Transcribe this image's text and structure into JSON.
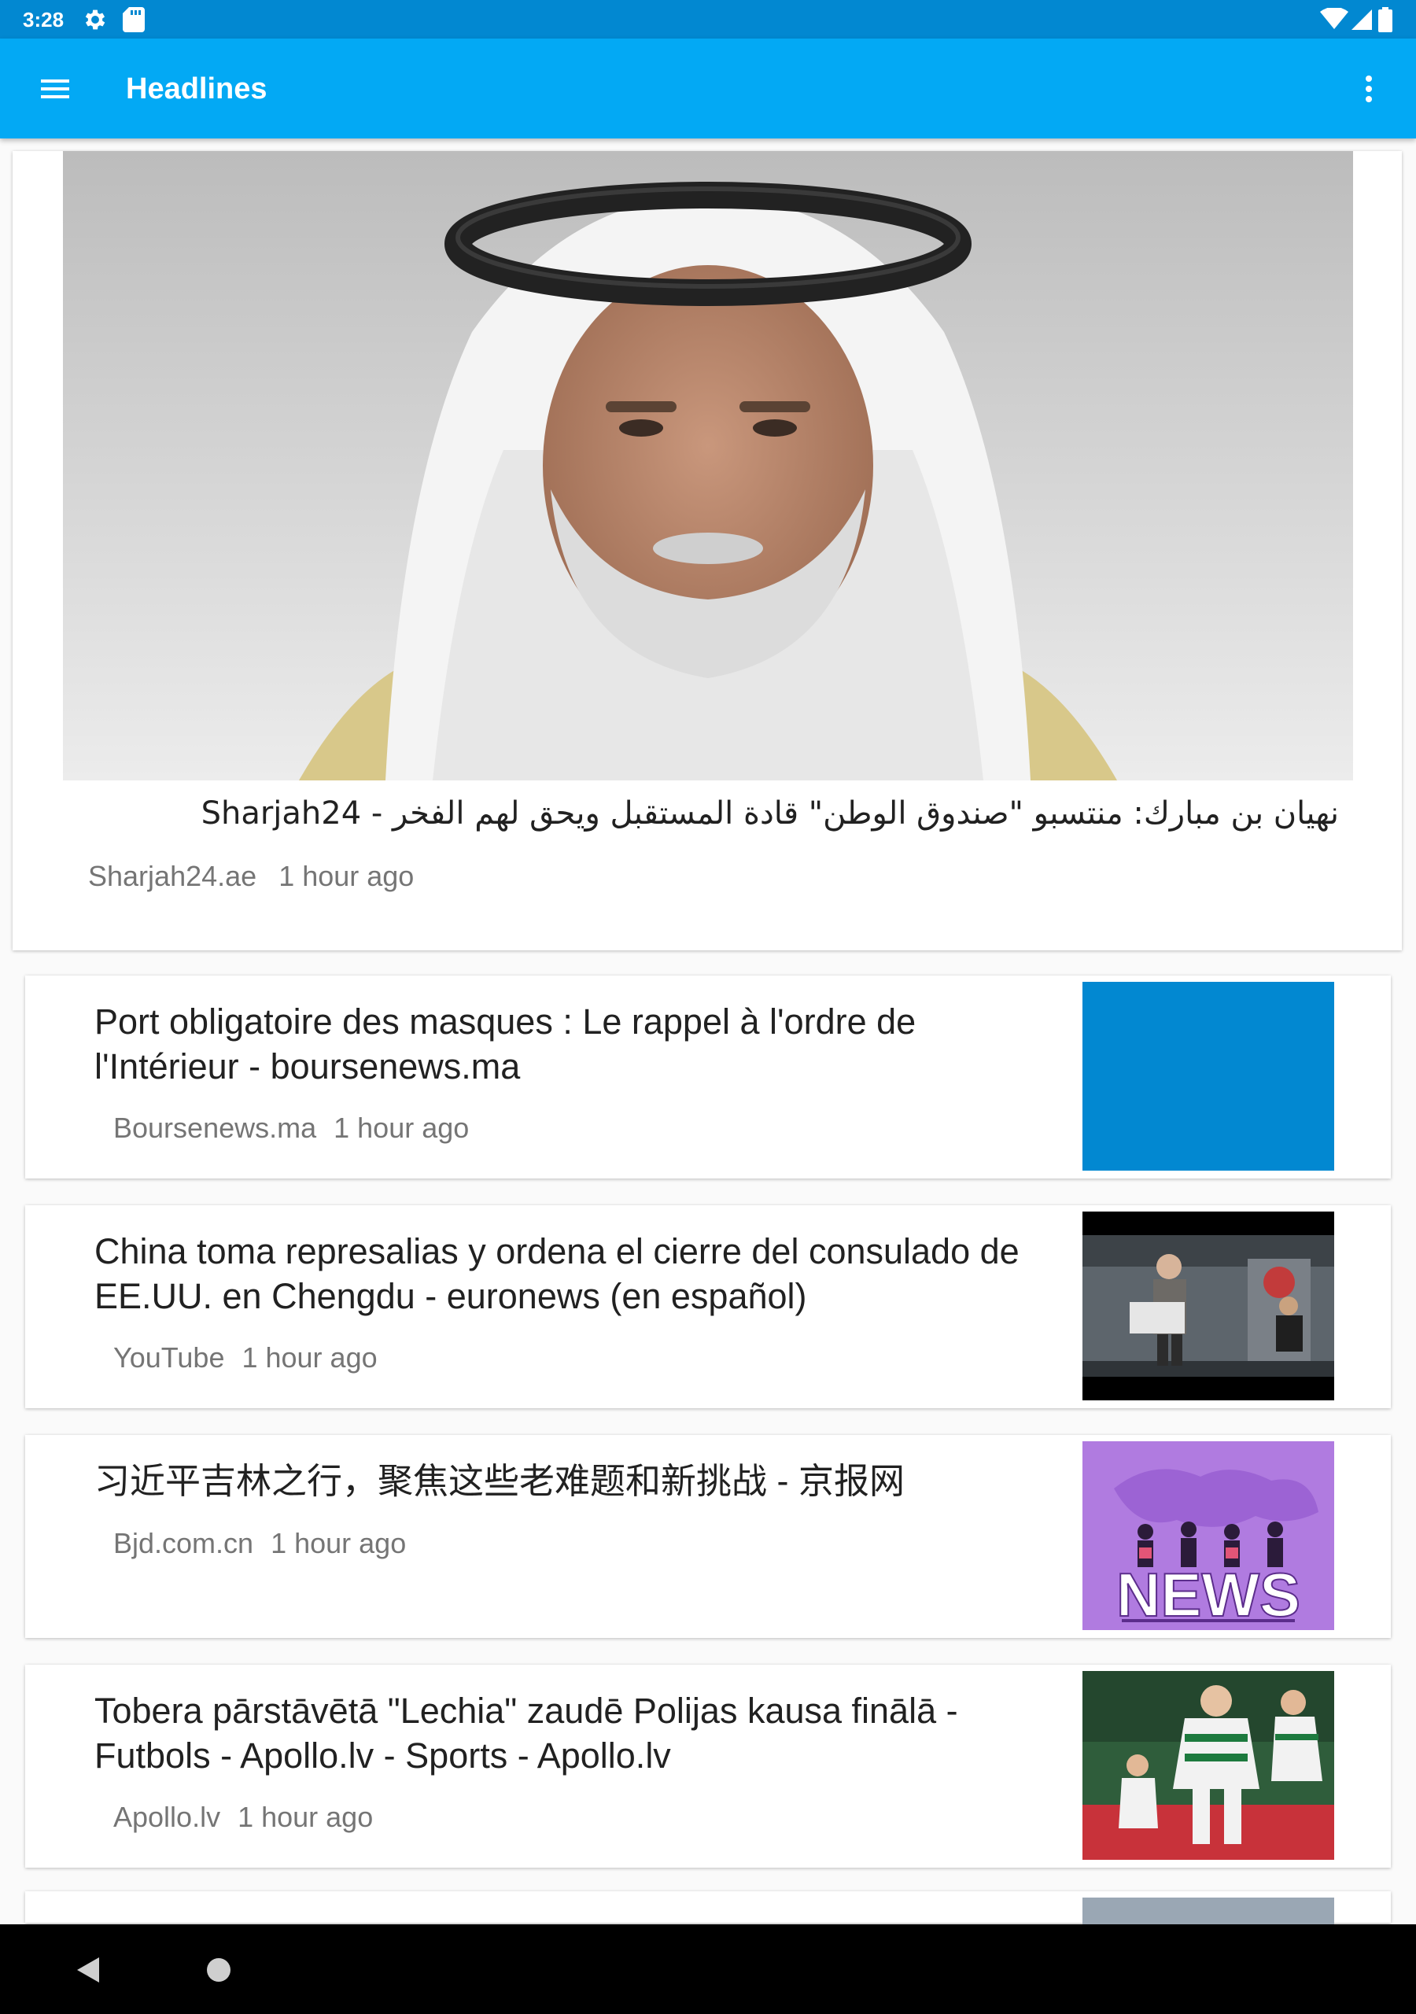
{
  "status_bar": {
    "time": "3:28",
    "icons": [
      "settings-gear-icon",
      "sd-card-icon",
      "wifi-icon",
      "signal-icon",
      "battery-icon"
    ]
  },
  "app_bar": {
    "title": "Headlines",
    "menu_icon": "hamburger-menu-icon",
    "overflow_icon": "more-vert-icon",
    "color": "#03a9f4",
    "status_color": "#0288d1"
  },
  "featured": {
    "title": "نهيان بن مبارك: منتسبو \"صندوق الوطن\" قادة المستقبل ويحق لهم الفخر - Sharjah24",
    "source": "Sharjah24.ae",
    "time": "1 hour ago"
  },
  "articles": [
    {
      "title": "Port obligatoire des masques : Le rappel à l'ordre de l'Intérieur - boursenews.ma",
      "source": "Boursenews.ma",
      "time": "1 hour ago",
      "thumb_color": "#0288d1"
    },
    {
      "title": "China toma represalias y ordena el cierre del consulado de EE.UU. en Chengdu - euronews (en español)",
      "source": "YouTube",
      "time": "1 hour ago"
    },
    {
      "title": "习近平吉林之行，聚焦这些老难题和新挑战 - 京报网",
      "source": "Bjd.com.cn",
      "time": "1 hour ago",
      "thumb_text": "NEWS"
    },
    {
      "title": "Tobera pārstāvētā \"Lechia\" zaudē Polijas kausa finālā - Futbols - Apollo.lv - Sports - Apollo.lv",
      "source": "Apollo.lv",
      "time": "1 hour ago"
    }
  ]
}
